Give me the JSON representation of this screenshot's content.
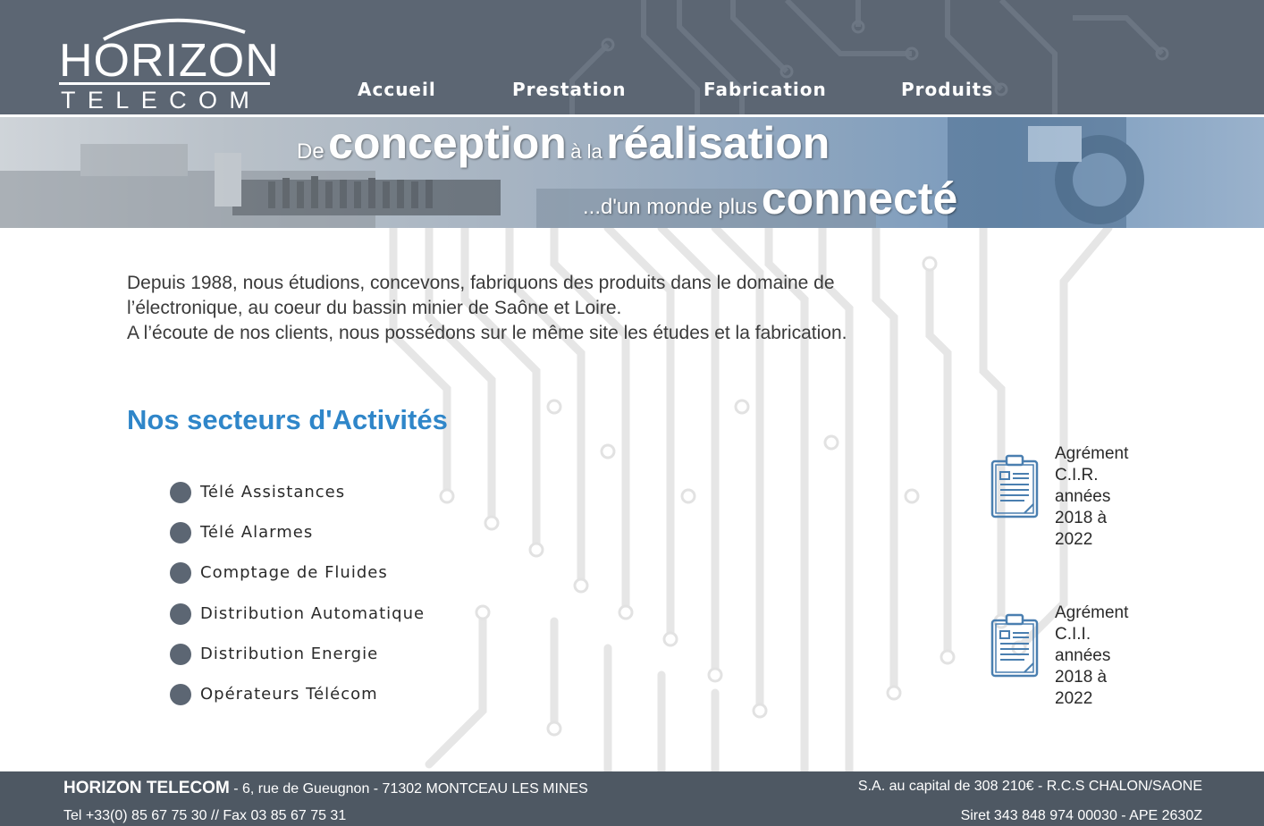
{
  "header": {
    "logo": {
      "line1": "HORIZON",
      "line2": "TELECOM"
    },
    "nav": [
      "Accueil",
      "Prestation",
      "Fabrication",
      "Produits"
    ]
  },
  "banner": {
    "line1": {
      "de": "De",
      "conception": "conception",
      "a_la": "à la",
      "realisation": "réalisation"
    },
    "line2": {
      "prefix": "...d'un monde plus",
      "connecte": "connecté"
    }
  },
  "intro": {
    "lines": [
      "Depuis 1988, nous étudions, concevons, fabriquons des produits dans le domaine de",
      "l’électronique, au coeur du bassin minier de Saône et Loire.",
      "A l’écoute de nos clients, nous possédons sur le même site les études et la fabrication."
    ]
  },
  "activities": {
    "title": "Nos secteurs d'Activités",
    "items": [
      "Télé Assistances",
      "Télé Alarmes",
      "Comptage de Fluides",
      "Distribution Automatique",
      "Distribution Energie",
      "Opérateurs Télécom"
    ]
  },
  "agrements": [
    {
      "lines": [
        "Agrément",
        "C.I.R.",
        "années",
        "2018 à",
        "2022"
      ],
      "icon": "clipboard-icon"
    },
    {
      "lines": [
        "Agrément",
        "C.I.I.",
        "années",
        "2018 à",
        "2022"
      ],
      "icon": "clipboard-icon"
    }
  ],
  "footer": {
    "company": "HORIZON TELECOM",
    "address": " - 6, rue de Gueugnon - 71302 MONTCEAU LES MINES",
    "phone": "Tel +33(0) 85 67 75 30 // Fax 03 85 67 75 31",
    "capital": "S.A. au capital de 308 210€ - R.C.S CHALON/SAONE",
    "siret": "Siret 343 848 974 00030 - APE 2630Z"
  },
  "colors": {
    "header_bg": "#5c6673",
    "footer_bg": "#4e5863",
    "title_blue": "#2f86c9",
    "icon_blue": "#4a7fb0"
  }
}
